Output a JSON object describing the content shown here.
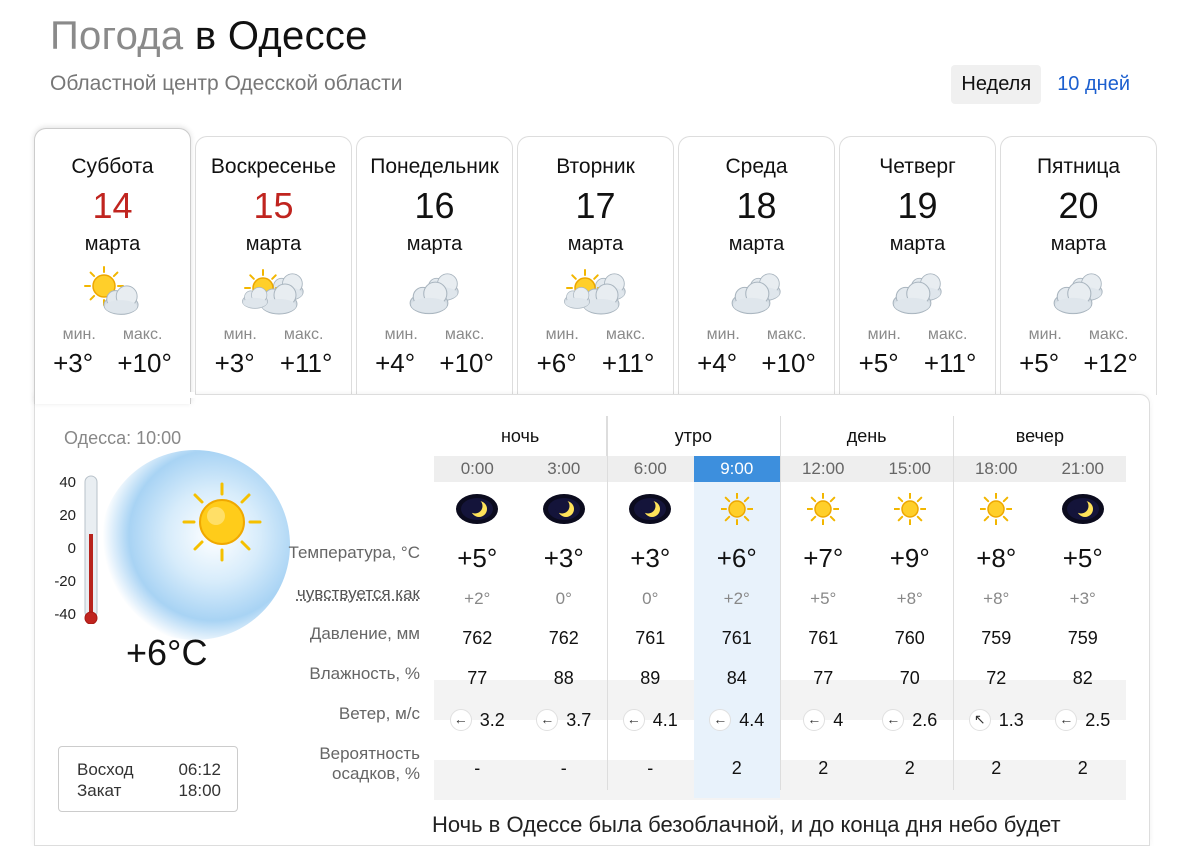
{
  "header": {
    "title_prefix": "Погода",
    "title_city": "в Одессе",
    "subtitle": "Областной центр Одесской области",
    "view_week": "Неделя",
    "view_10days": "10 дней"
  },
  "days": [
    {
      "name": "Суббота",
      "num": "14",
      "month": "марта",
      "min_label": "мин.",
      "max_label": "макс.",
      "min": "+3°",
      "max": "+10°",
      "icon": "sun-cloud-icon",
      "weekend": true,
      "selected": true
    },
    {
      "name": "Воскресенье",
      "num": "15",
      "month": "марта",
      "min_label": "мин.",
      "max_label": "макс.",
      "min": "+3°",
      "max": "+11°",
      "icon": "sun-clouds-icon",
      "weekend": true,
      "selected": false
    },
    {
      "name": "Понедельник",
      "num": "16",
      "month": "марта",
      "min_label": "мин.",
      "max_label": "макс.",
      "min": "+4°",
      "max": "+10°",
      "icon": "cloudy-icon",
      "weekend": false,
      "selected": false
    },
    {
      "name": "Вторник",
      "num": "17",
      "month": "марта",
      "min_label": "мин.",
      "max_label": "макс.",
      "min": "+6°",
      "max": "+11°",
      "icon": "sun-clouds-icon",
      "weekend": false,
      "selected": false
    },
    {
      "name": "Среда",
      "num": "18",
      "month": "марта",
      "min_label": "мин.",
      "max_label": "макс.",
      "min": "+4°",
      "max": "+10°",
      "icon": "cloudy-icon",
      "weekend": false,
      "selected": false
    },
    {
      "name": "Четверг",
      "num": "19",
      "month": "марта",
      "min_label": "мин.",
      "max_label": "макс.",
      "min": "+5°",
      "max": "+11°",
      "icon": "cloudy-icon",
      "weekend": false,
      "selected": false
    },
    {
      "name": "Пятница",
      "num": "20",
      "month": "марта",
      "min_label": "мин.",
      "max_label": "макс.",
      "min": "+5°",
      "max": "+12°",
      "icon": "cloudy-icon",
      "weekend": false,
      "selected": false
    }
  ],
  "current": {
    "label": "Одесса: 10:00",
    "temp": "+6°C",
    "scale": [
      "40",
      "20",
      "0",
      "-20",
      "-40"
    ],
    "sunrise_label": "Восход",
    "sunrise": "06:12",
    "sunset_label": "Закат",
    "sunset": "18:00"
  },
  "row_labels": {
    "temp": "Температура, °C",
    "feels": "чувствуется как",
    "pressure": "Давление, мм",
    "humidity": "Влажность, %",
    "wind": "Ветер, м/с",
    "precip_1": "Вероятность",
    "precip_2": "осадков, %"
  },
  "periods": [
    "ночь",
    "утро",
    "день",
    "вечер"
  ],
  "hours": [
    {
      "time": "0:00",
      "icon": "moon-icon",
      "temp": "+5°",
      "feels": "+2°",
      "pressure": "762",
      "humidity": "77",
      "wind_dir": "←",
      "wind": "3.2",
      "precip": "-"
    },
    {
      "time": "3:00",
      "icon": "moon-icon",
      "temp": "+3°",
      "feels": "0°",
      "pressure": "762",
      "humidity": "88",
      "wind_dir": "←",
      "wind": "3.7",
      "precip": "-"
    },
    {
      "time": "6:00",
      "icon": "moon-icon",
      "temp": "+3°",
      "feels": "0°",
      "pressure": "761",
      "humidity": "89",
      "wind_dir": "←",
      "wind": "4.1",
      "precip": "-"
    },
    {
      "time": "9:00",
      "icon": "sun-icon",
      "temp": "+6°",
      "feels": "+2°",
      "pressure": "761",
      "humidity": "84",
      "wind_dir": "←",
      "wind": "4.4",
      "precip": "2",
      "selected": true
    },
    {
      "time": "12:00",
      "icon": "sun-icon",
      "temp": "+7°",
      "feels": "+5°",
      "pressure": "761",
      "humidity": "77",
      "wind_dir": "←",
      "wind": "4",
      "precip": "2"
    },
    {
      "time": "15:00",
      "icon": "sun-icon",
      "temp": "+9°",
      "feels": "+8°",
      "pressure": "760",
      "humidity": "70",
      "wind_dir": "←",
      "wind": "2.6",
      "precip": "2"
    },
    {
      "time": "18:00",
      "icon": "sun-icon",
      "temp": "+8°",
      "feels": "+8°",
      "pressure": "759",
      "humidity": "72",
      "wind_dir": "↖",
      "wind": "1.3",
      "precip": "2"
    },
    {
      "time": "21:00",
      "icon": "moon-icon",
      "temp": "+5°",
      "feels": "+3°",
      "pressure": "759",
      "humidity": "82",
      "wind_dir": "←",
      "wind": "2.5",
      "precip": "2"
    }
  ],
  "bottom_text": "Ночь в Одессе была безоблачной, и до конца дня небо будет"
}
